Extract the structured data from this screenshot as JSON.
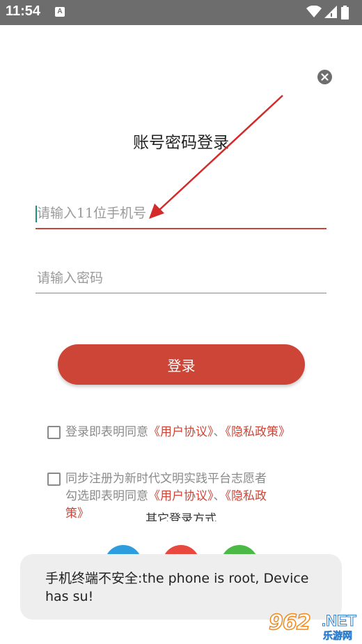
{
  "status_bar": {
    "time": "11:54",
    "notification_icon": "A"
  },
  "title": "账号密码登录",
  "phone": {
    "placeholder": "请输入11位手机号",
    "value": ""
  },
  "password": {
    "placeholder": "请输入密码",
    "value": ""
  },
  "login_button_label": "登录",
  "agreement_1": {
    "prefix": "登录即表明同意",
    "user_agreement": "《用户协议》",
    "separator": "、",
    "privacy_policy": "《隐私政策》"
  },
  "agreement_2": {
    "line1": "同步注册为新时代文明实践平台志愿者",
    "prefix": "勾选即表明同意",
    "user_agreement": "《用户协议》",
    "separator": "、",
    "privacy_part1": "《隐私政",
    "privacy_part2": "策》"
  },
  "other_login_label": "其它登录方式",
  "social_icons": [
    "qq-icon",
    "weibo-icon",
    "wechat-icon"
  ],
  "toast_message": "手机终端不安全:the phone is root, Device has su!",
  "watermark": {
    "number": "962",
    "suffix": ".NET",
    "subtitle": "乐游网"
  },
  "colors": {
    "status_bar": "#6d6d6d",
    "accent_red": "#cd4536",
    "annotation_arrow": "#d42a2a",
    "toast_bg": "#eeeeee"
  }
}
